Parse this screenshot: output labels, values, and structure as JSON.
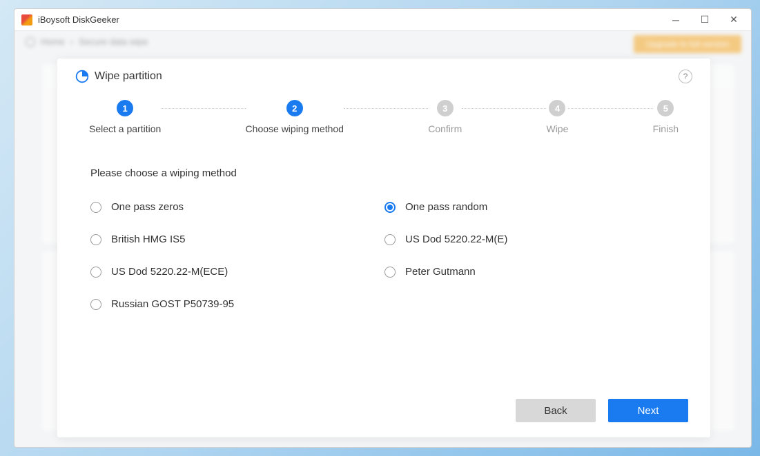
{
  "window": {
    "title": "iBoysoft DiskGeeker"
  },
  "background": {
    "breadcrumb_home": "Home",
    "breadcrumb_section": "Secure data wipe",
    "upgrade_label": "Upgrade to full version"
  },
  "modal": {
    "title": "Wipe partition"
  },
  "steps": [
    {
      "num": "1",
      "label": "Select a partition",
      "state": "active"
    },
    {
      "num": "2",
      "label": "Choose wiping method",
      "state": "active"
    },
    {
      "num": "3",
      "label": "Confirm",
      "state": "inactive"
    },
    {
      "num": "4",
      "label": "Wipe",
      "state": "inactive"
    },
    {
      "num": "5",
      "label": "Finish",
      "state": "inactive"
    }
  ],
  "section": {
    "prompt": "Please choose a wiping method"
  },
  "options": {
    "col1": [
      {
        "label": "One pass zeros",
        "selected": false
      },
      {
        "label": "British HMG IS5",
        "selected": false
      },
      {
        "label": "US Dod 5220.22-M(ECE)",
        "selected": false
      },
      {
        "label": "Russian GOST P50739-95",
        "selected": false
      }
    ],
    "col2": [
      {
        "label": "One pass random",
        "selected": true
      },
      {
        "label": "US Dod 5220.22-M(E)",
        "selected": false
      },
      {
        "label": "Peter Gutmann",
        "selected": false
      }
    ]
  },
  "buttons": {
    "back": "Back",
    "next": "Next"
  }
}
